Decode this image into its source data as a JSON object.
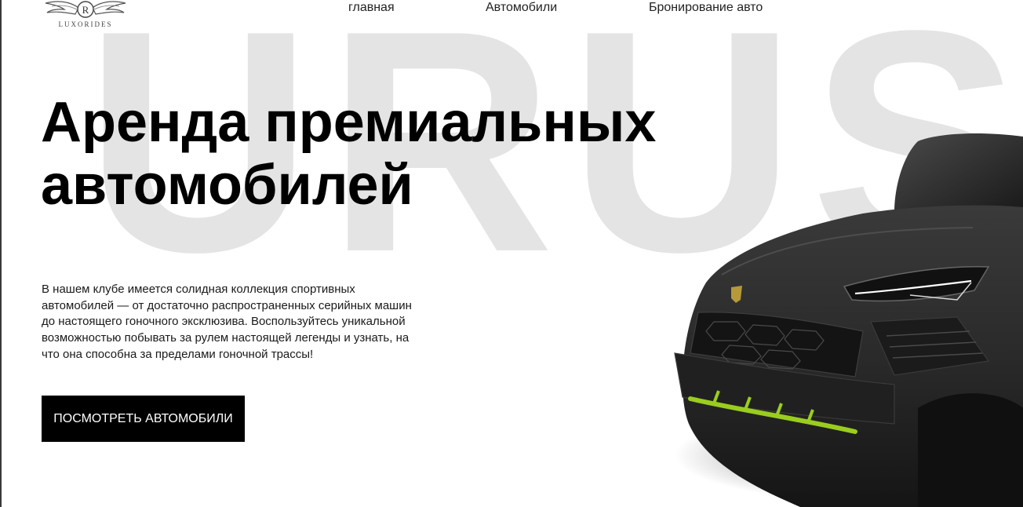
{
  "brand": {
    "logo_letter": "R",
    "name": "LUXORIDES"
  },
  "nav": {
    "items": [
      {
        "label": "главная"
      },
      {
        "label": "Автомобили"
      },
      {
        "label": "Бронирование авто"
      }
    ]
  },
  "hero": {
    "background_word": "URUS",
    "title": "Аренда премиальных\nавтомобилей",
    "description": "В нашем клубе имеется солидная коллекция спортивных автомобилей — от достаточно распространенных серийных машин до настоящего гоночного эксклюзива. Воспользуйтесь уникальной возможностью побывать за рулем настоящей легенды и узнать, на что она способна за пределами гоночной трассы!",
    "cta_label": "ПОСМОТРЕТЬ АВТОМОБИЛИ"
  },
  "colors": {
    "background": "#ffffff",
    "text": "#000000",
    "background_word": "#e4e4e4",
    "button_bg": "#000000",
    "button_text": "#ffffff",
    "car_body": "#2b2b2b",
    "car_accent": "#9acd1e"
  }
}
